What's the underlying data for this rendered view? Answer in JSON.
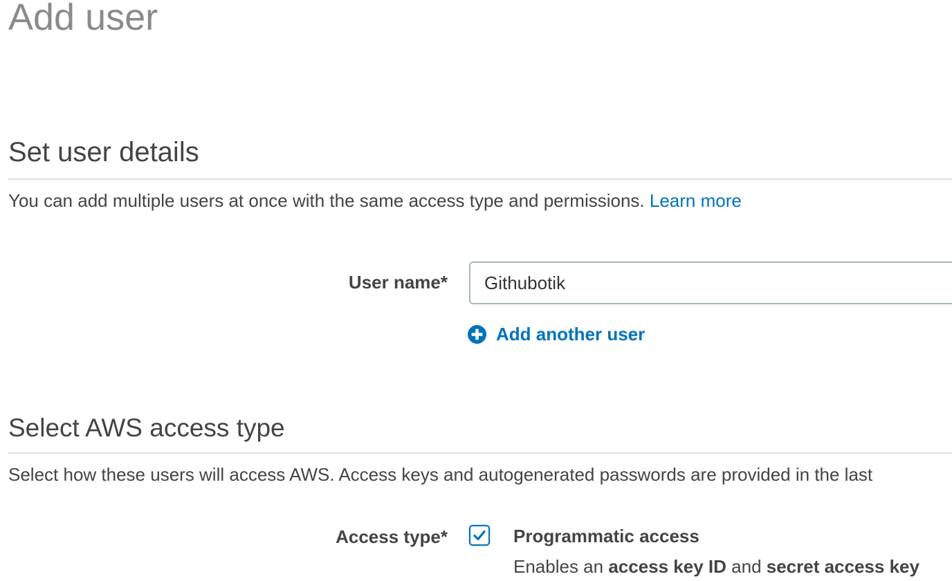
{
  "page": {
    "title": "Add user"
  },
  "details_section": {
    "title": "Set user details",
    "description": "You can add multiple users at once with the same access type and permissions. ",
    "learn_more": "Learn more",
    "user_name_label": "User name*",
    "user_name_value": "Githubotik",
    "add_another_user": "Add another user"
  },
  "access_section": {
    "title": "Select AWS access type",
    "description": "Select how these users will access AWS. Access keys and autogenerated passwords are provided in the last",
    "access_type_label": "Access type*",
    "option": {
      "title": "Programmatic access",
      "checked": true,
      "desc_prefix": "Enables an ",
      "desc_bold1": "access key ID",
      "desc_mid": " and ",
      "desc_bold2": "secret access key"
    }
  },
  "icons": {
    "add": "plus-circle-icon",
    "check": "checkmark-icon"
  },
  "colors": {
    "link": "#0073bb",
    "title_gray": "#8a8a8a",
    "text": "#444444",
    "divider": "#dddddd"
  }
}
